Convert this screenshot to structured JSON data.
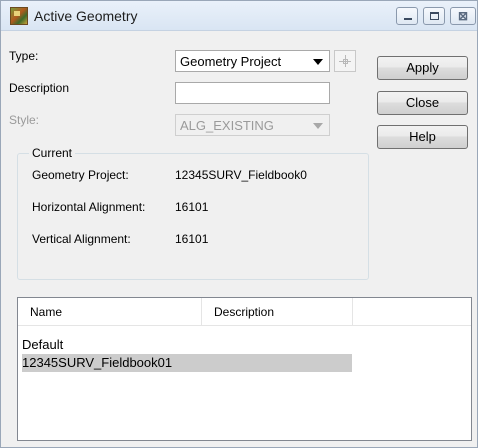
{
  "window": {
    "title": "Active Geometry",
    "controls": {
      "minimize": "",
      "maximize": "",
      "close": "⊠"
    }
  },
  "form": {
    "type_label": "Type:",
    "type_value": "Geometry Project",
    "description_label": "Description",
    "description_value": "",
    "style_label": "Style:",
    "style_value": "ALG_EXISTING"
  },
  "buttons": {
    "apply": "Apply",
    "close": "Close",
    "help": "Help"
  },
  "current": {
    "legend": "Current",
    "geometry_project_label": "Geometry Project:",
    "geometry_project_value": "12345SURV_Fieldbook0",
    "horizontal_label": "Horizontal Alignment:",
    "horizontal_value": "16101",
    "vertical_label": "Vertical Alignment:",
    "vertical_value": "16101"
  },
  "list": {
    "columns": [
      "Name",
      "Description"
    ],
    "rows": [
      {
        "name": "Default",
        "selected": false
      },
      {
        "name": "12345SURV_Fieldbook01",
        "selected": true
      }
    ]
  },
  "colors": {
    "selection": "#cccccc",
    "dialog_bg": "#f0f0f0",
    "disabled_text": "#9a9a9a"
  },
  "icons": {
    "app": "geometry-app-icon",
    "target": "crosshair-icon"
  }
}
